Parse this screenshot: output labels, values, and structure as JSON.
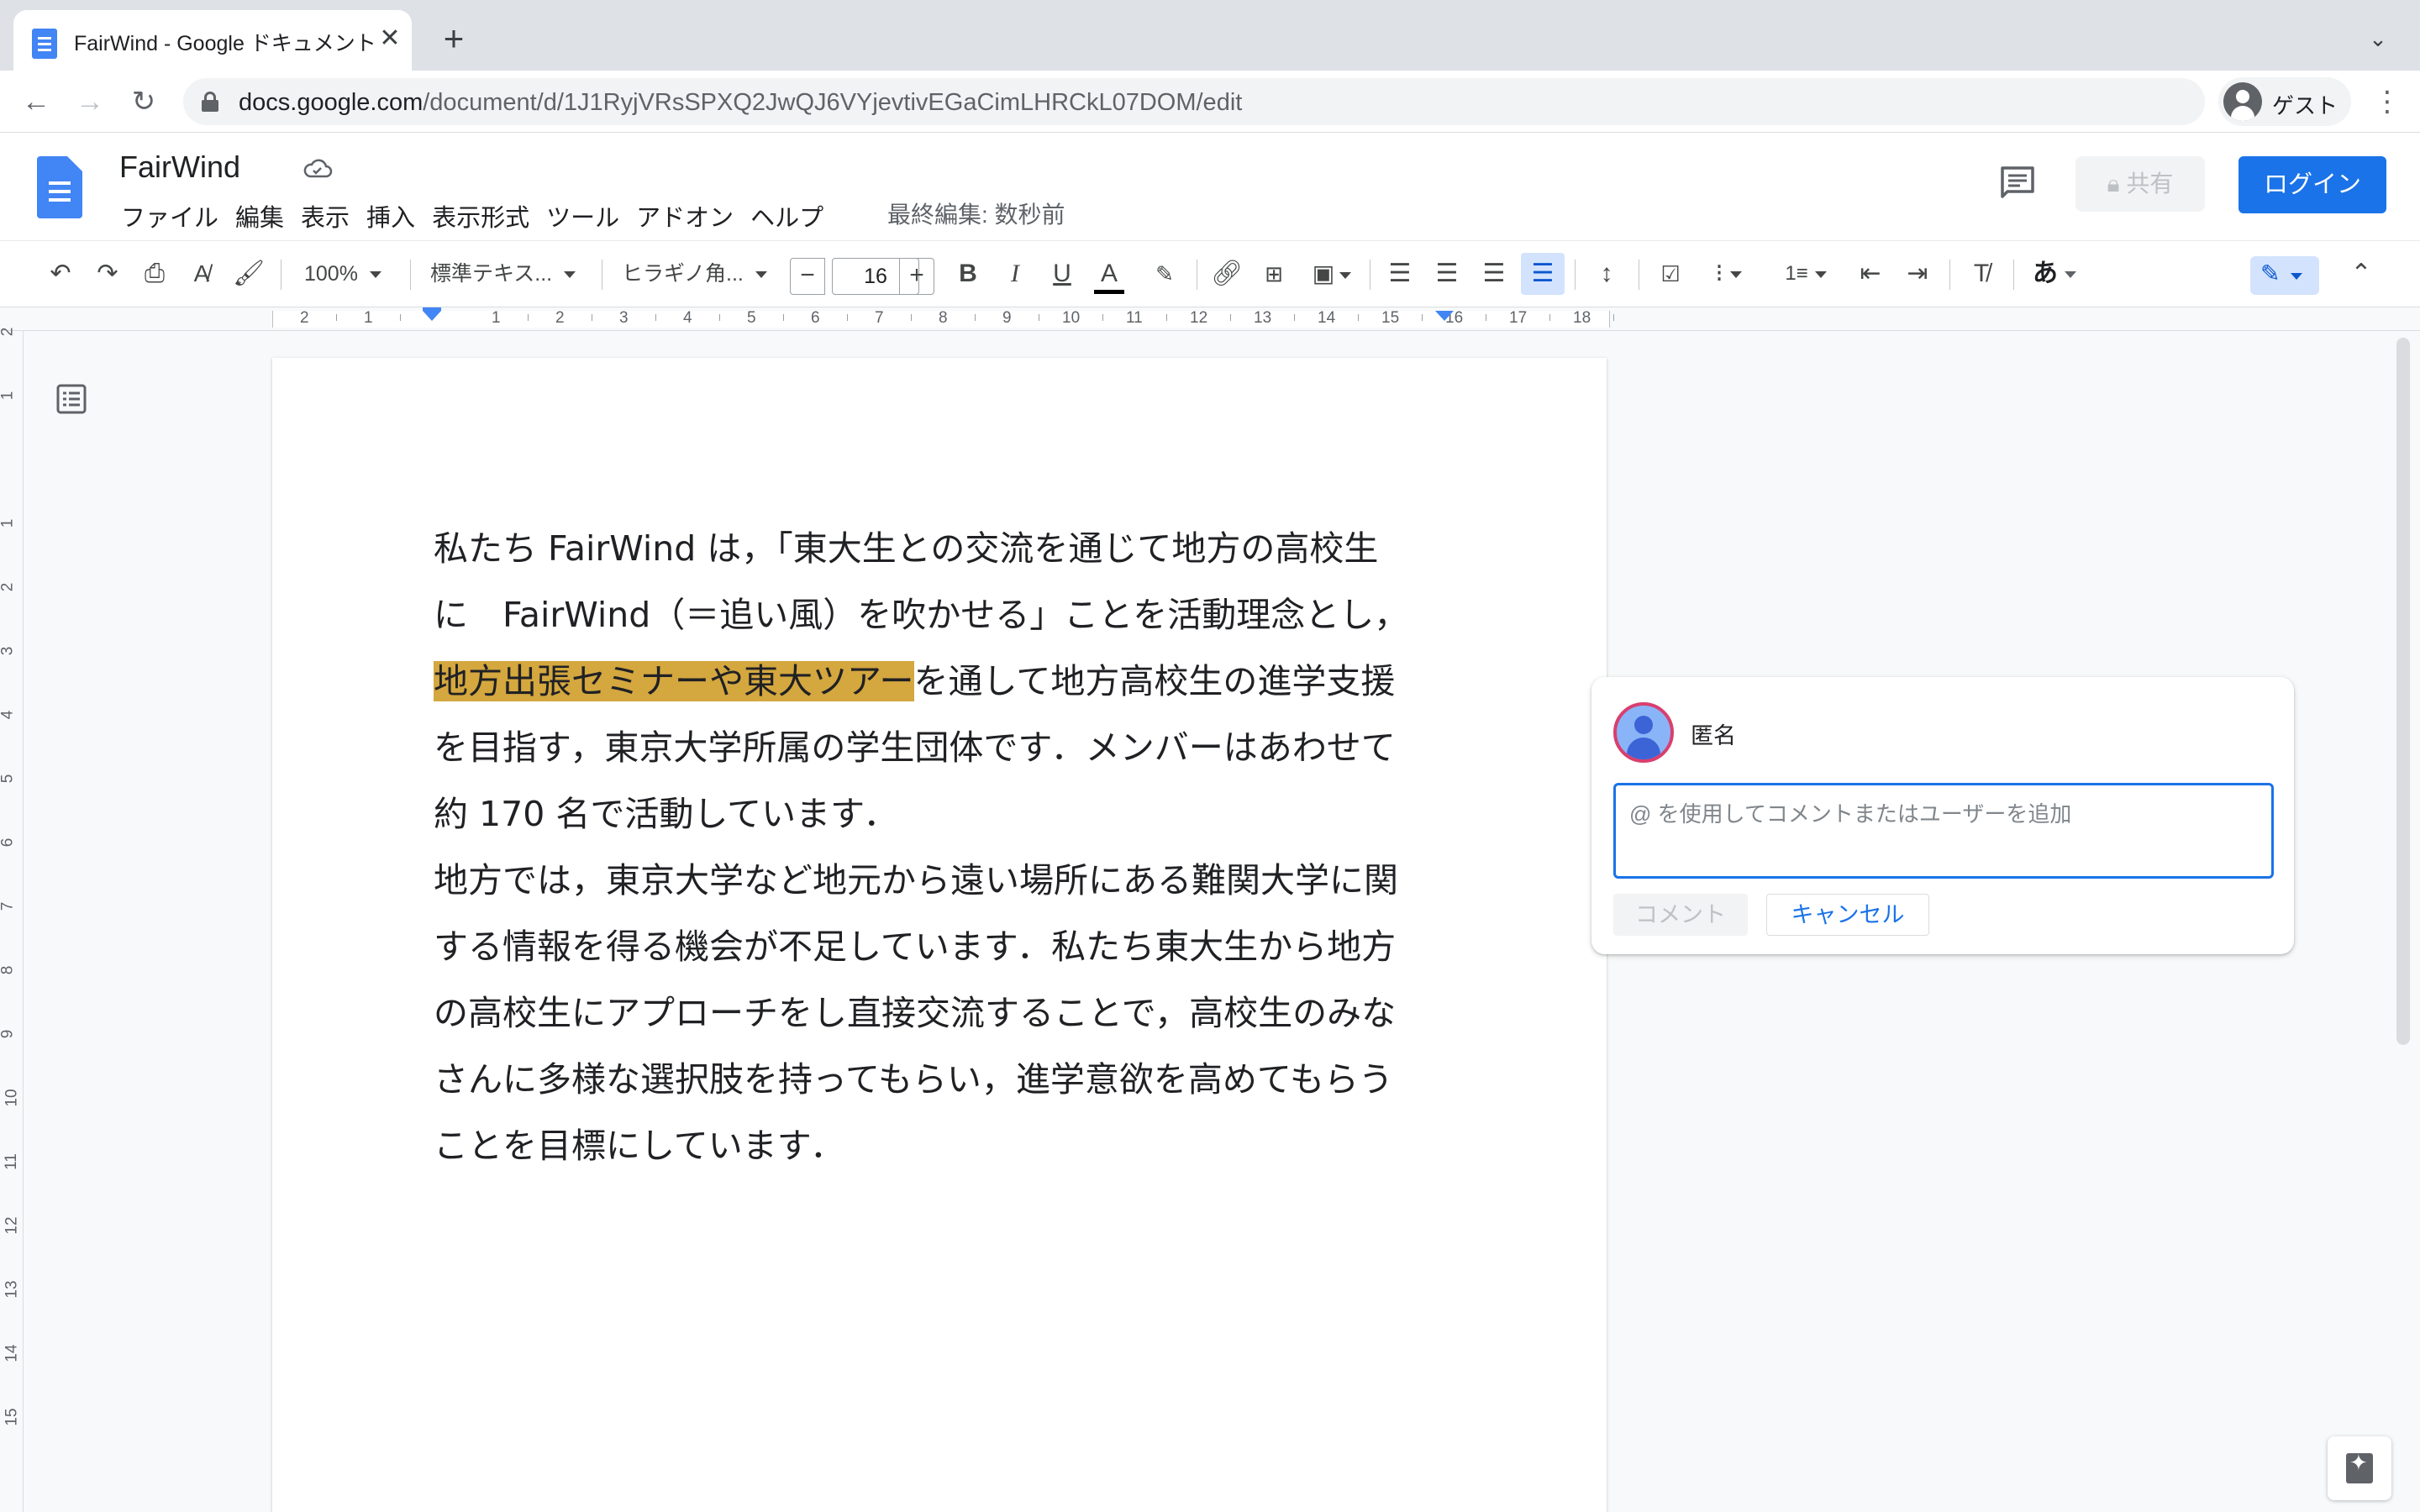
{
  "browser": {
    "tab_title": "FairWind - Google ドキュメント",
    "url_host": "docs.google.com",
    "url_path": "/document/d/1J1RyjVRsSPXQ2JwQJ6VYjevtivEGaCimLHRCkL07DOM/edit",
    "profile_label": "ゲスト"
  },
  "docs": {
    "title": "FairWind",
    "menu": [
      "ファイル",
      "編集",
      "表示",
      "挿入",
      "表示形式",
      "ツール",
      "アドオン",
      "ヘルプ"
    ],
    "last_edit": "最終編集: 数秒前",
    "share_label": "共有",
    "login_label": "ログイン"
  },
  "toolbar": {
    "zoom": "100%",
    "style": "標準テキス...",
    "font": "ヒラギノ角...",
    "font_size": "16",
    "input_mode": "あ"
  },
  "ruler": {
    "h_labels": [
      "2",
      "1",
      "1",
      "2",
      "3",
      "4",
      "5",
      "6",
      "7",
      "8",
      "9",
      "10",
      "11",
      "12",
      "13",
      "14",
      "15",
      "16",
      "17",
      "18"
    ],
    "v_labels": [
      "2",
      "1",
      "1",
      "2",
      "3",
      "4",
      "5",
      "6",
      "7",
      "8",
      "9",
      "10",
      "11",
      "12",
      "13",
      "14",
      "15"
    ]
  },
  "document": {
    "paragraph1": {
      "line1": "私たち FairWind は，「東大生との交流を通じて地方の高校生",
      "line2": "に　FairWind（＝追い風）を吹かせる」ことを活動理念とし，",
      "line3_highlight": "地方出張セミナーや東大ツアー",
      "line3_rest": "を通して地方高校生の進学支援",
      "line4": "を目指す，東京大学所属の学生団体です．メンバーはあわせて",
      "line5": "約 170 名で活動しています．"
    },
    "paragraph2": {
      "line1": "地方では，東京大学など地元から遠い場所にある難関大学に関",
      "line2": "する情報を得る機会が不足しています．私たち東大生から地方",
      "line3": "の高校生にアプローチをし直接交流することで，高校生のみな",
      "line4": "さんに多様な選択肢を持ってもらい，進学意欲を高めてもらう",
      "line5": "ことを目標にしています．"
    }
  },
  "comment": {
    "author": "匿名",
    "placeholder": "@ を使用してコメントまたはユーザーを追加",
    "submit_label": "コメント",
    "cancel_label": "キャンセル"
  },
  "colors": {
    "accent": "#1a73e8",
    "highlight": "#d4a73f",
    "docs_blue": "#4285f4"
  }
}
